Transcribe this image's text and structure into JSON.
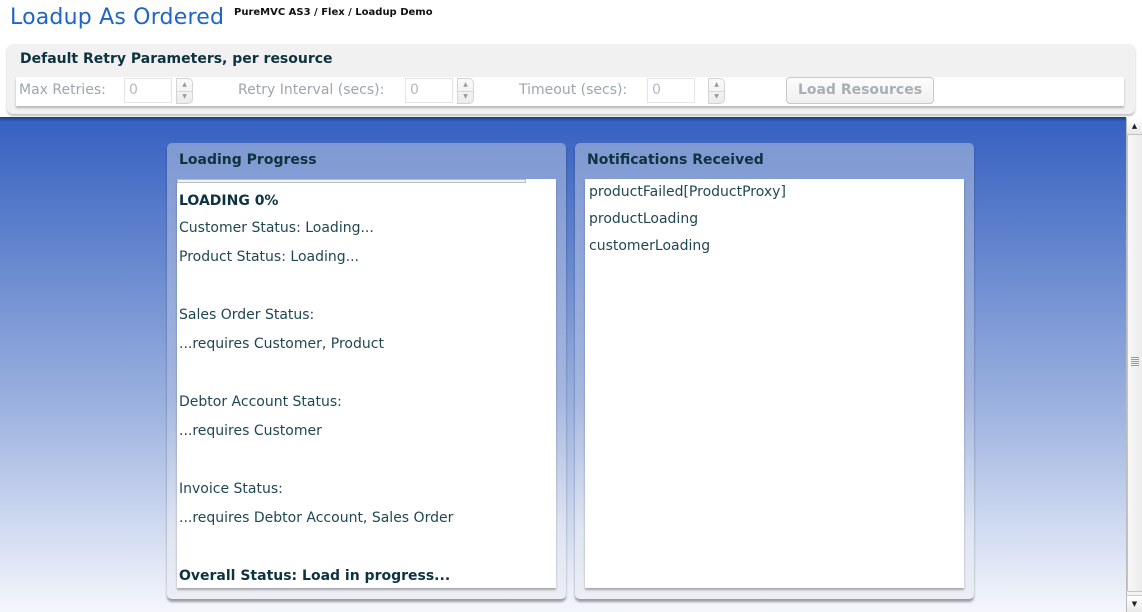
{
  "header": {
    "title": "Loadup As Ordered",
    "subtitle": "PureMVC AS3 / Flex / Loadup Demo"
  },
  "retry_params": {
    "title": "Default Retry Parameters, per resource",
    "max_retries_label": "Max Retries:",
    "max_retries_value": "0",
    "retry_interval_label": "Retry Interval (secs):",
    "retry_interval_value": "0",
    "timeout_label": "Timeout (secs):",
    "timeout_value": "0",
    "load_button_label": "Load Resources",
    "spin_up_glyph": "▲",
    "spin_down_glyph": "▼"
  },
  "loading_progress": {
    "title": "Loading Progress",
    "progress_percent": 0,
    "lines": [
      "LOADING 0%",
      "Customer Status: Loading...",
      "Product Status: Loading...",
      "Sales Order Status:",
      "...requires Customer, Product",
      "Debtor Account Status:",
      "...requires Customer",
      "Invoice Status:",
      "...requires Debtor Account, Sales Order",
      "Overall Status: Load in progress..."
    ]
  },
  "notifications": {
    "title": "Notifications Received",
    "items": [
      "productFailed[ProductProxy]",
      "productLoading",
      "customerLoading"
    ]
  },
  "scrollbar": {
    "up_glyph": "▲",
    "down_glyph": "▼"
  },
  "colors": {
    "title_blue": "#1f64c8",
    "heading_dark": "#0d3340",
    "background_blue": "#3761c1"
  }
}
